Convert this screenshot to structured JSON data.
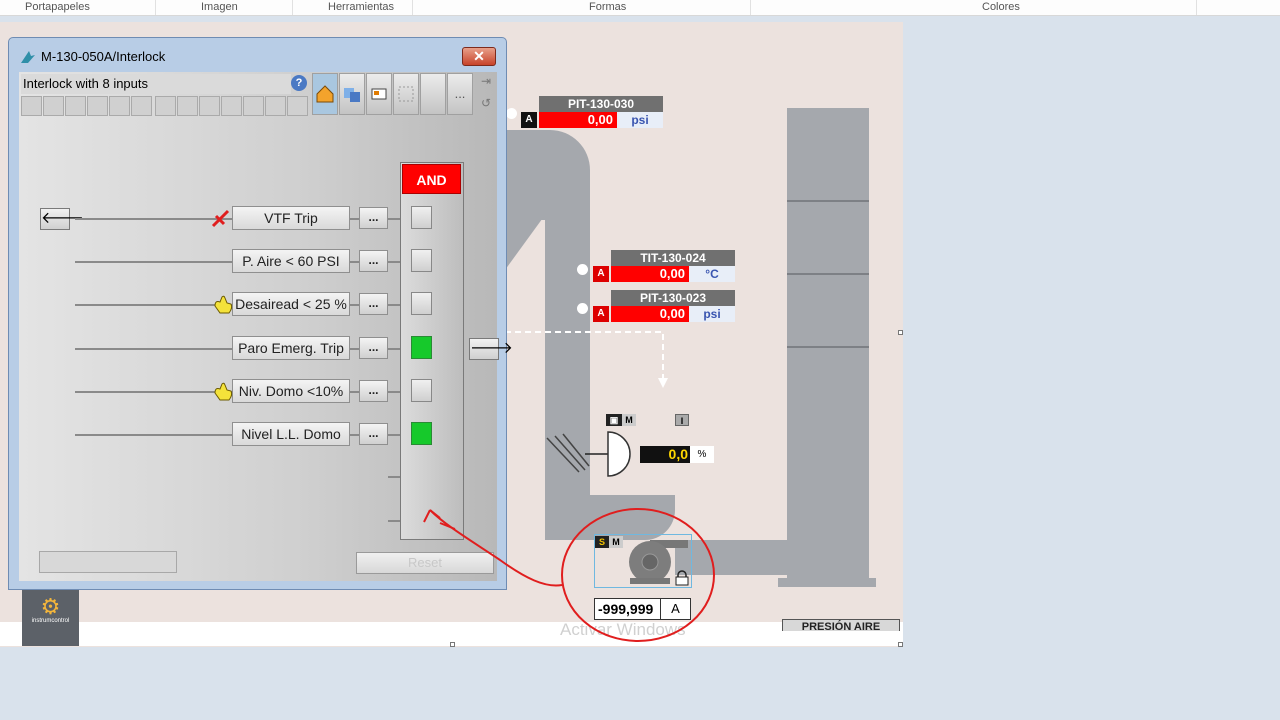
{
  "ribbon": {
    "groups": [
      "Portapapeles",
      "Imagen",
      "Herramientas",
      "Formas",
      "Colores"
    ]
  },
  "dialog": {
    "title": "M-130-050A/Interlock",
    "header": "Interlock with 8 inputs",
    "close_symbol": "✕",
    "more_label": "...",
    "gate_label": "AND",
    "reset_label": "Reset",
    "inputs": [
      {
        "label": "VTF Trip",
        "dots": "...",
        "state": "off",
        "marker": "bypass-icon"
      },
      {
        "label": "P. Aire < 60 PSI",
        "dots": "...",
        "state": "off",
        "marker": ""
      },
      {
        "label": "Desairead < 25 %",
        "dots": "...",
        "state": "off",
        "marker": "hand-icon"
      },
      {
        "label": "Paro Emerg. Trip",
        "dots": "...",
        "state": "on",
        "marker": ""
      },
      {
        "label": "Niv. Domo <10%",
        "dots": "...",
        "state": "off",
        "marker": "hand-icon"
      },
      {
        "label": "Nivel L.L. Domo",
        "dots": "...",
        "state": "on",
        "marker": ""
      }
    ]
  },
  "tags": [
    {
      "name": "PIT-130-030",
      "value": "0,00",
      "unit": "psi",
      "mark": "A"
    },
    {
      "name": "TIT-130-024",
      "value": "0,00",
      "unit": "°C",
      "mark": "A"
    },
    {
      "name": "PIT-130-023",
      "value": "0,00",
      "unit": "psi",
      "mark": "A"
    }
  ],
  "valve": {
    "mode": "M",
    "interlock": "I",
    "value": "0,0",
    "unit": "%"
  },
  "motor": {
    "mode_s": "S",
    "mode_m": "M",
    "current": "-999,999",
    "unit": "A"
  },
  "labels": {
    "presion": "PRESIÓN AIRE",
    "watermark": "Activar Windows",
    "logo": "instrumcontrol"
  },
  "colors": {
    "alarm_red": "#ff0000",
    "on_green": "#16c92b",
    "struct_gray": "#a5a8ad",
    "annotation_red": "#e01e1e"
  }
}
